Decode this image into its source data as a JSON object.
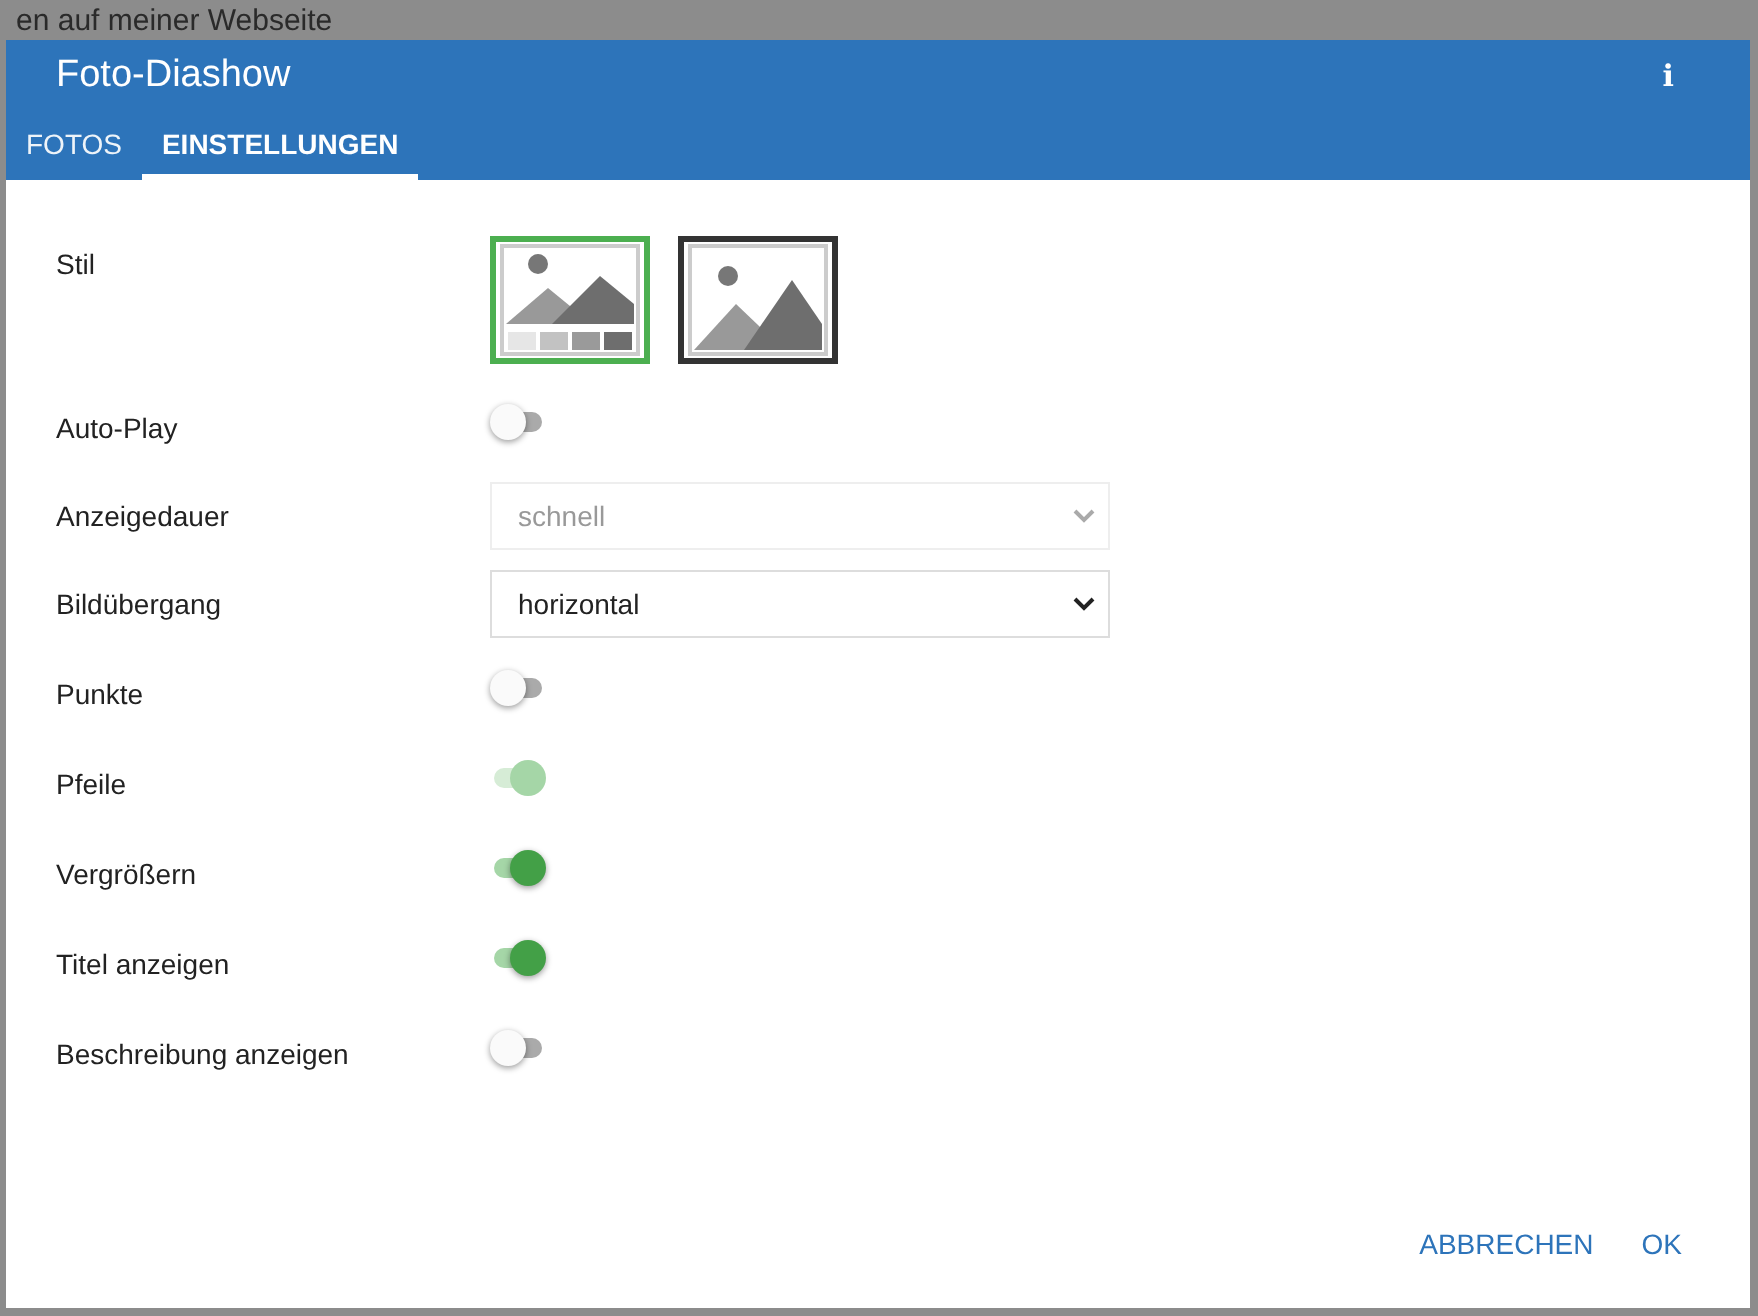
{
  "background": {
    "heading": "en auf meiner Webseite"
  },
  "dialog": {
    "title": "Foto-Diashow",
    "info_icon": "i"
  },
  "tabs": [
    {
      "label": "FOTOS",
      "selected": false
    },
    {
      "label": "EINSTELLUNGEN",
      "selected": true
    }
  ],
  "settings": [
    {
      "kind": "style",
      "label": "Stil",
      "options": [
        {
          "kind": "thumbnails",
          "selected": true
        },
        {
          "kind": "single",
          "selected": false
        }
      ]
    },
    {
      "kind": "toggle",
      "label": "Auto-Play",
      "on": false,
      "disabled": false
    },
    {
      "kind": "select",
      "label": "Anzeigedauer",
      "value": "schnell",
      "disabled": true
    },
    {
      "kind": "select",
      "label": "Bildübergang",
      "value": "horizontal",
      "disabled": false
    },
    {
      "kind": "toggle",
      "label": "Punkte",
      "on": false,
      "disabled": false
    },
    {
      "kind": "toggle",
      "label": "Pfeile",
      "on": true,
      "disabled": true
    },
    {
      "kind": "toggle",
      "label": "Vergrößern",
      "on": true,
      "disabled": false
    },
    {
      "kind": "toggle",
      "label": "Titel anzeigen",
      "on": true,
      "disabled": false
    },
    {
      "kind": "toggle",
      "label": "Beschreibung anzeigen",
      "on": false,
      "disabled": false
    }
  ],
  "buttons": [
    "ABBRECHEN",
    "OK"
  ]
}
